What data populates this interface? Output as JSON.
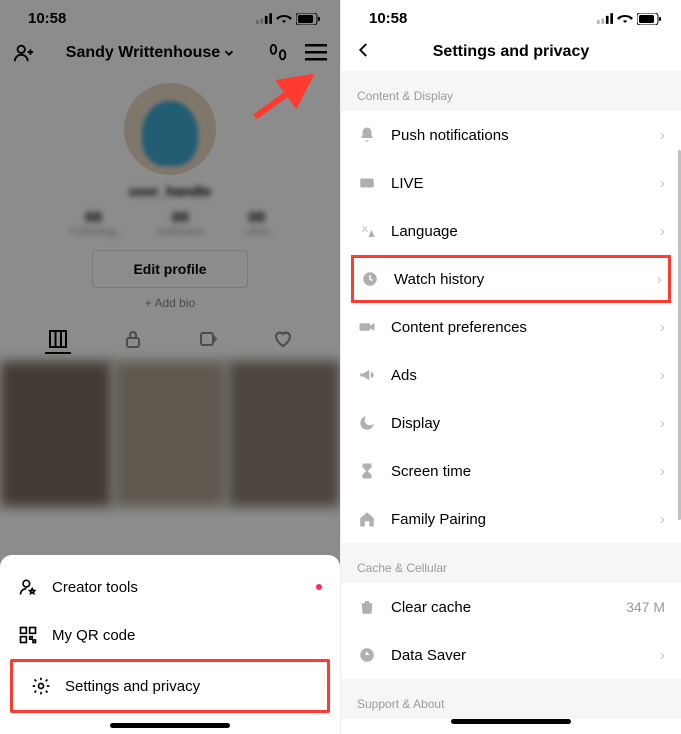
{
  "status": {
    "time": "10:58"
  },
  "left": {
    "profileName": "Sandy Writtenhouse",
    "username": "user_handle",
    "editProfile": "Edit profile",
    "addBio": "+ Add bio",
    "sheet": {
      "creatorTools": "Creator tools",
      "qrCode": "My QR code",
      "settings": "Settings and privacy"
    }
  },
  "right": {
    "title": "Settings and privacy",
    "sections": {
      "contentDisplay": "Content & Display",
      "cacheCellular": "Cache & Cellular",
      "supportAbout": "Support & About"
    },
    "rows": {
      "push": "Push notifications",
      "live": "LIVE",
      "language": "Language",
      "watchHistory": "Watch history",
      "contentPrefs": "Content preferences",
      "ads": "Ads",
      "display": "Display",
      "screenTime": "Screen time",
      "familyPairing": "Family Pairing",
      "clearCache": "Clear cache",
      "clearCacheValue": "347 M",
      "dataSaver": "Data Saver"
    }
  }
}
